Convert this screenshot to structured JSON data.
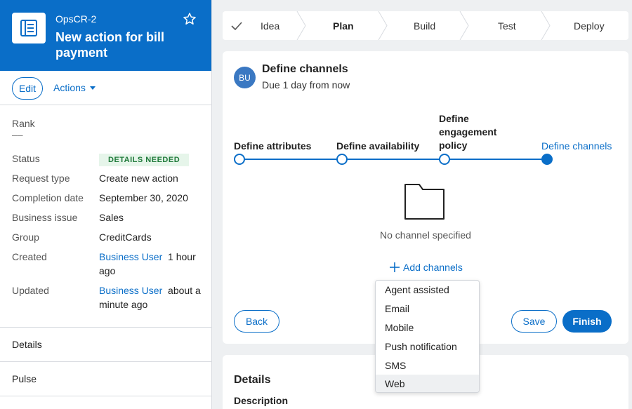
{
  "case": {
    "id": "OpsCR-2",
    "title": "New action for bill payment"
  },
  "toolbar": {
    "edit_label": "Edit",
    "actions_label": "Actions"
  },
  "fields": {
    "rank_label": "Rank",
    "rank_value": "––",
    "status_label": "Status",
    "status_value": "DETAILS NEEDED",
    "request_type_label": "Request type",
    "request_type_value": "Create new action",
    "completion_date_label": "Completion date",
    "completion_date_value": "September 30, 2020",
    "business_issue_label": "Business issue",
    "business_issue_value": "Sales",
    "group_label": "Group",
    "group_value": "CreditCards",
    "created_label": "Created",
    "created_user": "Business User",
    "created_time": "1 hour ago",
    "updated_label": "Updated",
    "updated_user": "Business User",
    "updated_time": "about a minute ago"
  },
  "left_nav": {
    "details": "Details",
    "pulse": "Pulse"
  },
  "stages": [
    {
      "label": "Idea",
      "done": true
    },
    {
      "label": "Plan",
      "current": true
    },
    {
      "label": "Build"
    },
    {
      "label": "Test"
    },
    {
      "label": "Deploy"
    }
  ],
  "task": {
    "avatar": "BU",
    "title": "Define channels",
    "due": "Due 1 day from now"
  },
  "steps": [
    {
      "label": "Define attributes"
    },
    {
      "label": "Define availability"
    },
    {
      "label": "Define engagement policy"
    },
    {
      "label": "Define channels",
      "current": true
    }
  ],
  "empty_state": {
    "message": "No channel specified",
    "add_label": "Add channels"
  },
  "buttons": {
    "back": "Back",
    "save": "Save",
    "finish": "Finish"
  },
  "details_section": {
    "title": "Details",
    "description_label": "Description"
  },
  "channel_menu": {
    "options": [
      "Agent assisted",
      "Email",
      "Mobile",
      "Push notification",
      "SMS",
      "Web"
    ],
    "highlighted": "Web"
  },
  "colors": {
    "brand": "#0a6ec8",
    "badge_bg": "#e6f5ea",
    "badge_text": "#1f7a3a"
  }
}
